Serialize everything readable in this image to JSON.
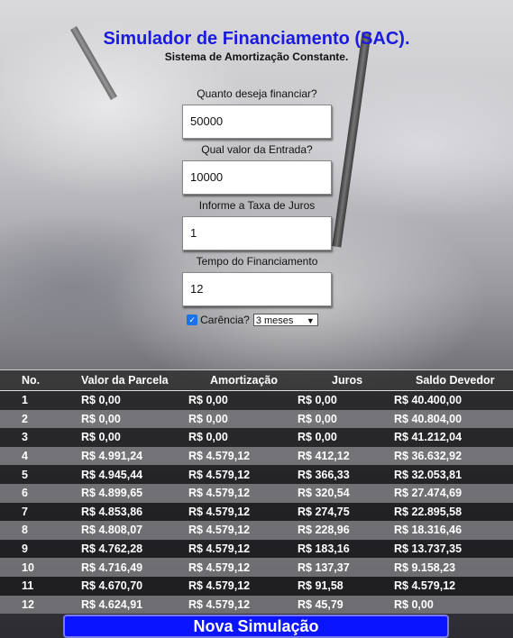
{
  "header": {
    "title": "Simulador de Financiamento (SAC).",
    "subtitle": "Sistema de Amortização Constante."
  },
  "form": {
    "amount_label": "Quanto deseja financiar?",
    "amount_value": "50000",
    "down_label": "Qual valor da Entrada?",
    "down_value": "10000",
    "rate_label": "Informe a Taxa de Juros",
    "rate_value": "1",
    "term_label": "Tempo do Financiamento",
    "term_value": "12",
    "grace_label": "Carência?",
    "grace_checked": true,
    "grace_option": "3 meses"
  },
  "table": {
    "headers": [
      "No.",
      "Valor da Parcela",
      "Amortização",
      "Juros",
      "Saldo Devedor"
    ],
    "rows": [
      [
        "1",
        "R$ 0,00",
        "R$ 0,00",
        "R$ 0,00",
        "R$ 40.400,00"
      ],
      [
        "2",
        "R$ 0,00",
        "R$ 0,00",
        "R$ 0,00",
        "R$ 40.804,00"
      ],
      [
        "3",
        "R$ 0,00",
        "R$ 0,00",
        "R$ 0,00",
        "R$ 41.212,04"
      ],
      [
        "4",
        "R$ 4.991,24",
        "R$ 4.579,12",
        "R$ 412,12",
        "R$ 36.632,92"
      ],
      [
        "5",
        "R$ 4.945,44",
        "R$ 4.579,12",
        "R$ 366,33",
        "R$ 32.053,81"
      ],
      [
        "6",
        "R$ 4.899,65",
        "R$ 4.579,12",
        "R$ 320,54",
        "R$ 27.474,69"
      ],
      [
        "7",
        "R$ 4.853,86",
        "R$ 4.579,12",
        "R$ 274,75",
        "R$ 22.895,58"
      ],
      [
        "8",
        "R$ 4.808,07",
        "R$ 4.579,12",
        "R$ 228,96",
        "R$ 18.316,46"
      ],
      [
        "9",
        "R$ 4.762,28",
        "R$ 4.579,12",
        "R$ 183,16",
        "R$ 13.737,35"
      ],
      [
        "10",
        "R$ 4.716,49",
        "R$ 4.579,12",
        "R$ 137,37",
        "R$ 9.158,23"
      ],
      [
        "11",
        "R$ 4.670,70",
        "R$ 4.579,12",
        "R$ 91,58",
        "R$ 4.579,12"
      ],
      [
        "12",
        "R$ 4.624,91",
        "R$ 4.579,12",
        "R$ 45,79",
        "R$ 0,00"
      ]
    ]
  },
  "actions": {
    "new_simulation": "Nova Simulação"
  }
}
